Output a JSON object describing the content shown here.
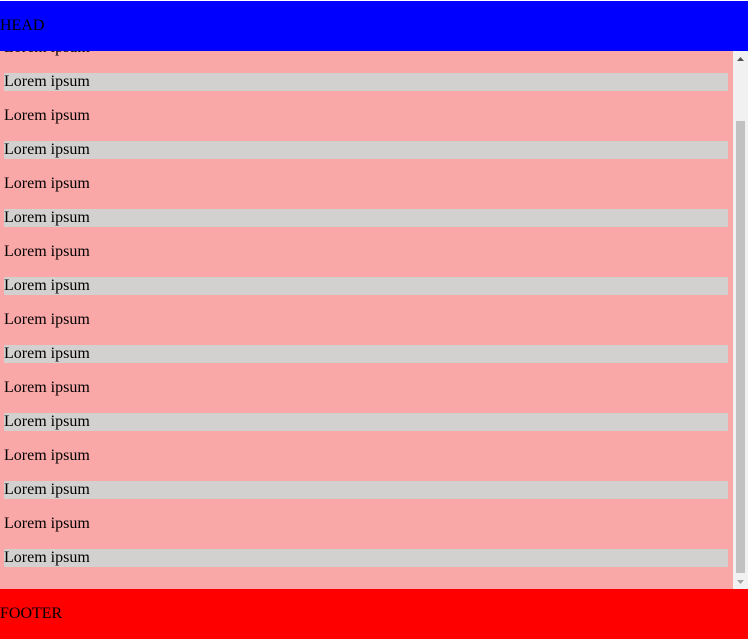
{
  "header": {
    "label": "HEAD"
  },
  "footer": {
    "label": "FOOTER"
  },
  "content": {
    "rows": [
      {
        "text": "Lorem ipsum",
        "shaded": false
      },
      {
        "text": "Lorem ipsum",
        "shaded": true
      },
      {
        "text": "Lorem ipsum",
        "shaded": false
      },
      {
        "text": "Lorem ipsum",
        "shaded": true
      },
      {
        "text": "Lorem ipsum",
        "shaded": false
      },
      {
        "text": "Lorem ipsum",
        "shaded": true
      },
      {
        "text": "Lorem ipsum",
        "shaded": false
      },
      {
        "text": "Lorem ipsum",
        "shaded": true
      },
      {
        "text": "Lorem ipsum",
        "shaded": false
      },
      {
        "text": "Lorem ipsum",
        "shaded": true
      },
      {
        "text": "Lorem ipsum",
        "shaded": false
      },
      {
        "text": "Lorem ipsum",
        "shaded": true
      },
      {
        "text": "Lorem ipsum",
        "shaded": false
      },
      {
        "text": "Lorem ipsum",
        "shaded": true
      },
      {
        "text": "Lorem ipsum",
        "shaded": false
      },
      {
        "text": "Lorem ipsum",
        "shaded": true
      }
    ]
  },
  "scrollbar": {
    "up_icon": "arrow-up-icon",
    "down_icon": "arrow-down-icon"
  },
  "colors": {
    "header": "#0000ff",
    "footer": "#ff0000",
    "content_background": "#f9a7a7",
    "shaded_row": "#d3d0d0"
  }
}
